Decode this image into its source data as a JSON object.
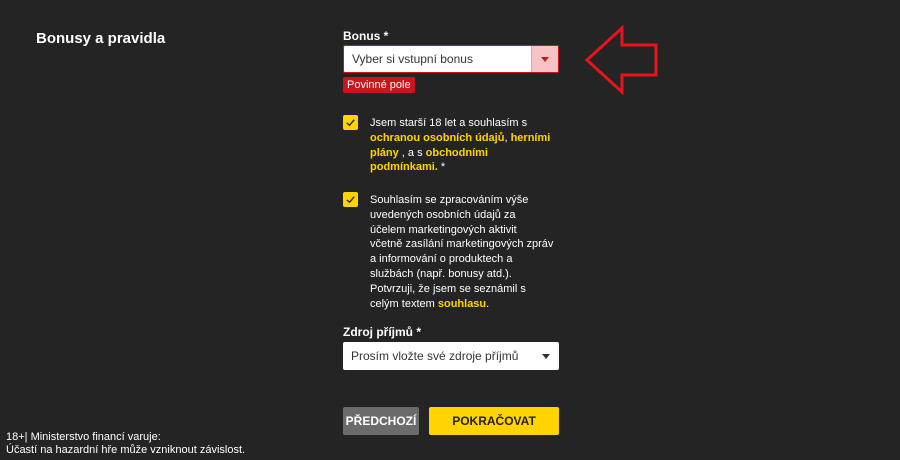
{
  "section": {
    "title": "Bonusy a pravidla"
  },
  "bonus": {
    "label": "Bonus *",
    "selected": "Vyber si vstupní bonus",
    "error": "Povinné pole"
  },
  "consent_terms": {
    "lines": [
      [
        {
          "text": "Jsem starší 18 let a souhlasím s",
          "link": false
        }
      ],
      [
        {
          "text": "ochranou osobních údajů",
          "link": true
        },
        {
          "text": ", ",
          "link": false
        },
        {
          "text": "herními",
          "link": true
        }
      ],
      [
        {
          "text": "plány",
          "link": true
        },
        {
          "text": " , a s ",
          "link": false
        },
        {
          "text": "obchodními",
          "link": true
        }
      ],
      [
        {
          "text": "podmínkami.",
          "link": true
        },
        {
          "text": " *",
          "link": false
        }
      ]
    ]
  },
  "consent_marketing": {
    "lines": [
      [
        {
          "text": "Souhlasím se zpracováním výše",
          "link": false
        }
      ],
      [
        {
          "text": "uvedených osobních údajů za",
          "link": false
        }
      ],
      [
        {
          "text": "účelem marketingových aktivit",
          "link": false
        }
      ],
      [
        {
          "text": "včetně zasílání marketingových zpráv",
          "link": false
        }
      ],
      [
        {
          "text": "a informování o produktech a",
          "link": false
        }
      ],
      [
        {
          "text": "službách (např. bonusy atd.).",
          "link": false
        }
      ],
      [
        {
          "text": "Potvrzuji, že jsem se seznámil s",
          "link": false
        }
      ],
      [
        {
          "text": "celým textem ",
          "link": false
        },
        {
          "text": "souhlasu",
          "link": true
        },
        {
          "text": ".",
          "link": false
        }
      ]
    ]
  },
  "income": {
    "label": "Zdroj příjmů *",
    "selected": "Prosím vložte své zdroje příjmů"
  },
  "buttons": {
    "back": "PŘEDCHOZÍ",
    "next": "POKRAČOVAT"
  },
  "footer": {
    "line1": "18+| Ministerstvo financí varuje:",
    "line2": "Účastí na hazardní hře může vzniknout závislost."
  },
  "colors": {
    "background": "#242424",
    "accent": "#ffd400",
    "error": "#c9151d",
    "annotation_arrow": "#e8141c"
  },
  "icons": {
    "checkbox": "check-icon",
    "dropdown": "chevron-down-icon",
    "annotation": "arrow-left-icon"
  }
}
